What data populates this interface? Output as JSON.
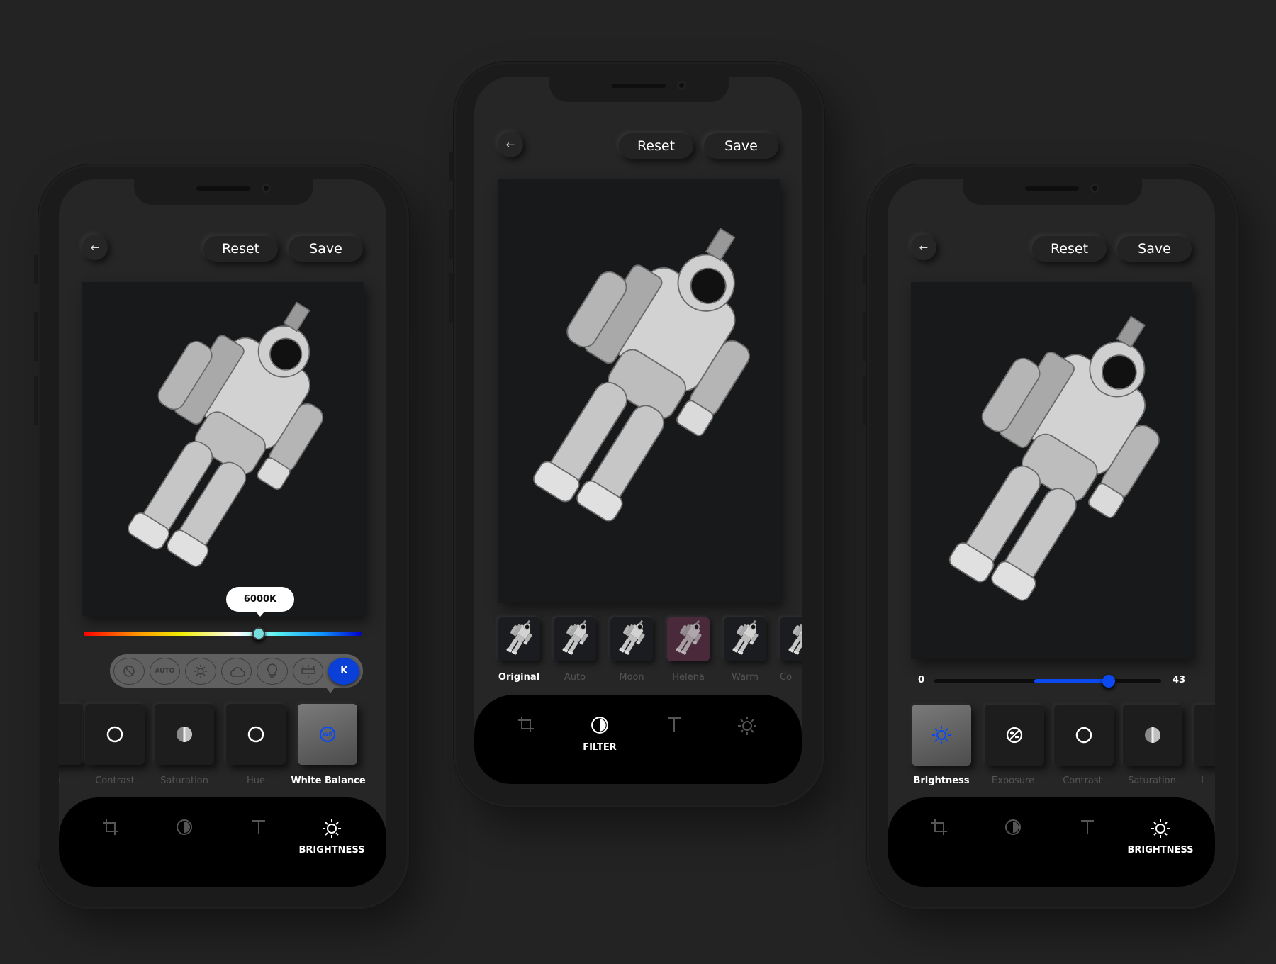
{
  "colors": {
    "background": "#232323",
    "accent_blue": "#0b4af0",
    "wb_knob": "#77dddd",
    "helena_tint": "#4a2a3a"
  },
  "phone_left": {
    "reset_label": "Reset",
    "save_label": "Save",
    "temperature": {
      "value_label": "6000K",
      "position": 0.63
    },
    "wb_presets": [
      {
        "icon": "no-flash-icon"
      },
      {
        "label": "AUTO",
        "icon": "auto-icon"
      },
      {
        "icon": "sun-icon"
      },
      {
        "icon": "cloud-icon"
      },
      {
        "icon": "bulb-icon"
      },
      {
        "icon": "fluorescent-icon"
      },
      {
        "label": "K",
        "icon": "kelvin-icon",
        "selected": true
      }
    ],
    "tools": [
      {
        "label": "re"
      },
      {
        "label": "Contrast"
      },
      {
        "label": "Saturation"
      },
      {
        "label": "Hue"
      },
      {
        "label": "White Balance",
        "active": true
      }
    ],
    "nav": {
      "active_label": "BRIGHTNESS",
      "items": [
        "crop-icon",
        "filter-icon",
        "text-icon",
        "brightness-icon"
      ]
    }
  },
  "phone_center": {
    "reset_label": "Reset",
    "save_label": "Save",
    "filters": [
      {
        "label": "Original",
        "selected": true
      },
      {
        "label": "Auto"
      },
      {
        "label": "Moon"
      },
      {
        "label": "Helena"
      },
      {
        "label": "Warm"
      },
      {
        "label": "Co"
      }
    ],
    "nav": {
      "active_label": "FILTER",
      "items": [
        "crop-icon",
        "filter-icon",
        "text-icon",
        "brightness-icon"
      ]
    }
  },
  "phone_right": {
    "reset_label": "Reset",
    "save_label": "Save",
    "slider": {
      "min_label": "0",
      "value_label": "43",
      "position": 0.77,
      "fill_start": 0.44
    },
    "tools": [
      {
        "label": "Brightness",
        "active": true
      },
      {
        "label": "Exposure"
      },
      {
        "label": "Contrast"
      },
      {
        "label": "Saturation"
      },
      {
        "label": "I"
      }
    ],
    "nav": {
      "active_label": "BRIGHTNESS",
      "items": [
        "crop-icon",
        "filter-icon",
        "text-icon",
        "brightness-icon"
      ]
    }
  }
}
